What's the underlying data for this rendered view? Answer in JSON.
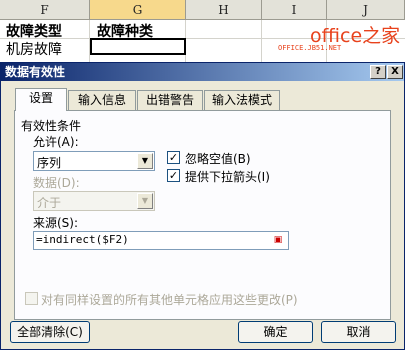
{
  "sheet": {
    "columns": [
      "F",
      "G",
      "H",
      "I",
      "J"
    ],
    "row1": {
      "f": "故障类型",
      "g": "故障种类"
    },
    "row2": {
      "f": "机房故障"
    },
    "watermark": "office之家",
    "watermark_url": "OFFICE.JB51.NET"
  },
  "dialog": {
    "title": "数据有效性",
    "help_button": "?",
    "close_button": "X",
    "tabs": [
      "设置",
      "输入信息",
      "出错警告",
      "输入法模式"
    ],
    "group_label": "有效性条件",
    "allow_label": "允许(A):",
    "allow_value": "序列",
    "data_label": "数据(D):",
    "data_value": "介于",
    "ignore_blank_label": "忽略空值(B)",
    "ignore_blank_checked": true,
    "dropdown_label": "提供下拉箭头(I)",
    "dropdown_checked": true,
    "source_label": "来源(S):",
    "source_value": "=indirect($F2)",
    "apply_all_label": "对有同样设置的所有其他单元格应用这些更改(P)",
    "clear_all_button": "全部清除(C)",
    "ok_button": "确定",
    "cancel_button": "取消"
  }
}
